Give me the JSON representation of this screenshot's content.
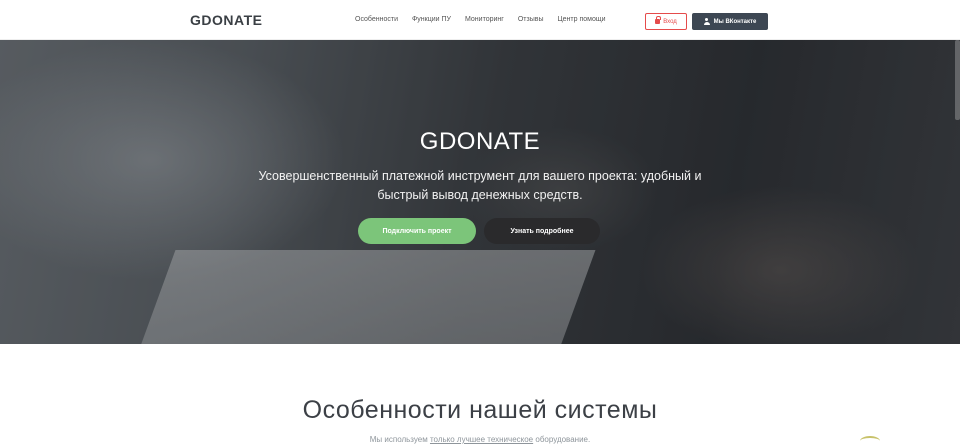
{
  "header": {
    "logo": "GDONATE",
    "nav": [
      "Особенности",
      "Функции ПУ",
      "Мониторинг",
      "Отзывы",
      "Центр помощи"
    ],
    "login_label": "Вход",
    "vk_label": "Мы ВКонтакте"
  },
  "hero": {
    "title": "GDONATE",
    "subtitle": "Усовершенственный платежной инструмент для вашего проекта: удобный и быстрый вывод денежных средств.",
    "connect_label": "Подключить проект",
    "more_label": "Узнать подробнее"
  },
  "features": {
    "title": "Особенности нашей системы",
    "sub_before": "Мы используем ",
    "sub_link": "только лучшее техническое",
    "sub_after": " оборудование."
  },
  "colors": {
    "accent_green": "#7cc57a",
    "login_red": "#e54b4b",
    "vk_dark": "#3d4753"
  },
  "icons": {
    "login": "lock-icon",
    "vk": "user-icon"
  }
}
